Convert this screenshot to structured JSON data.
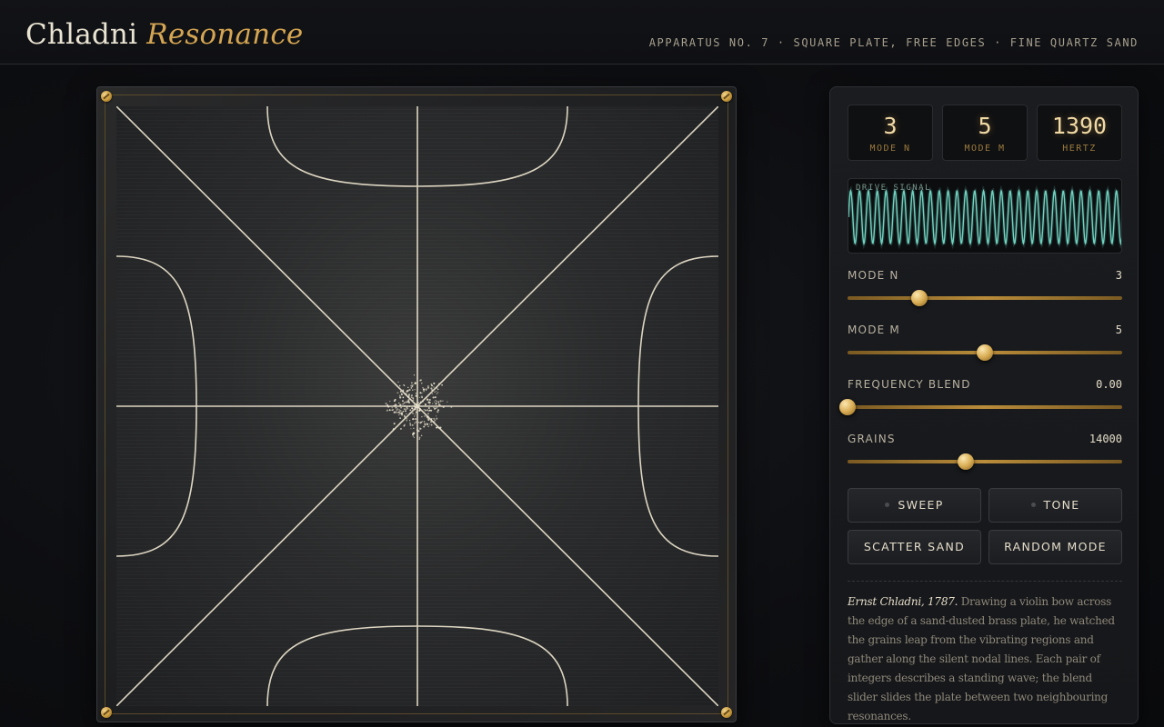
{
  "header": {
    "title_main": "Chladni",
    "title_accent": "Resonance",
    "subtitle": "APPARATUS NO. 7 · SQUARE PLATE, FREE EDGES · FINE QUARTZ SAND"
  },
  "readouts": [
    {
      "value": "3",
      "label": "MODE N"
    },
    {
      "value": "5",
      "label": "MODE M"
    },
    {
      "value": "1390",
      "label": "HERTZ"
    }
  ],
  "scope": {
    "label": "DRIVE SIGNAL",
    "color": "#6fd3c0"
  },
  "sliders": [
    {
      "label": "MODE N",
      "value": "3",
      "level": 0.26
    },
    {
      "label": "MODE M",
      "value": "5",
      "level": 0.5
    },
    {
      "label": "FREQUENCY BLEND",
      "value": "0.00",
      "level": 0.0
    },
    {
      "label": "GRAINS",
      "value": "14000",
      "level": 0.43
    }
  ],
  "buttons": {
    "sweep": "SWEEP",
    "tone": "TONE",
    "scatter": "SCATTER SAND",
    "random": "RANDOM MODE"
  },
  "note": {
    "who": "Ernst Chladni, 1787.",
    "text": "Drawing a violin bow across the edge of a sand-dusted brass plate, he watched the grains leap from the vibrating regions and gather along the silent nodal lines. Each pair of integers describes a standing wave; the blend slider slides the plate between two neighbouring resonances."
  },
  "colors": {
    "accent": "#d4a552",
    "sand": "#ece4cf",
    "scope_wave": "#6fd3c0"
  },
  "icons": {
    "screw": "screw-icon",
    "led": "led-indicator-icon"
  }
}
